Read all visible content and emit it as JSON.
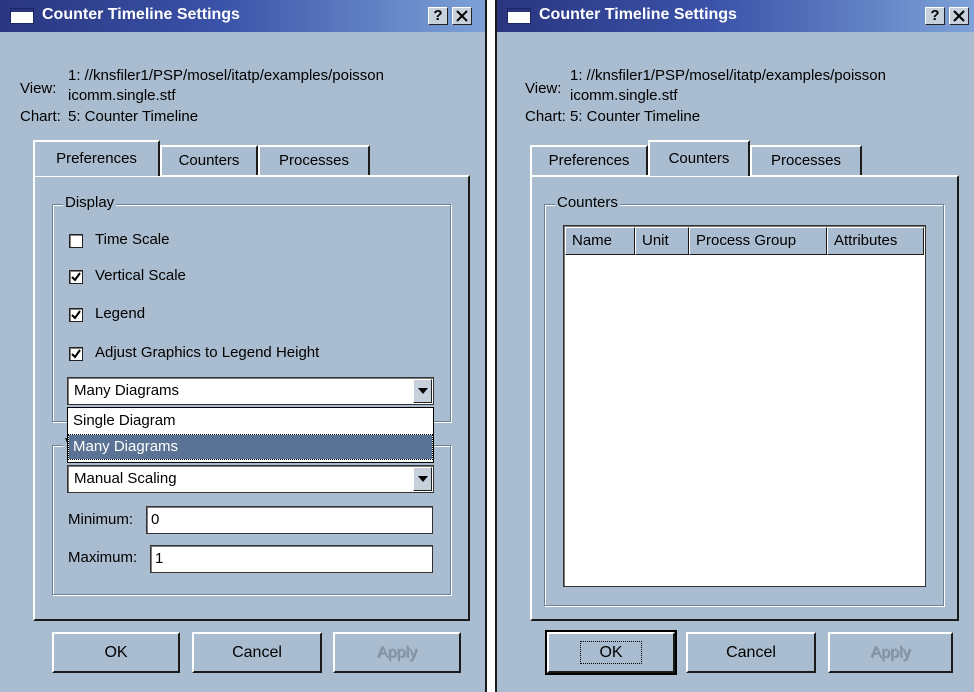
{
  "left_dialog": {
    "title": "Counter Timeline Settings",
    "help_button": "?",
    "close_button": "✕",
    "view_label": "View:",
    "view_value_line1": "1: //knsfiler1/PSP/mosel/itatp/examples/poisson",
    "view_value_line2": "icomm.single.stf",
    "chart_label": "Chart:",
    "chart_value": "5: Counter Timeline",
    "tabs": [
      "Preferences",
      "Counters",
      "Processes"
    ],
    "active_tab": "Preferences",
    "display_group": {
      "label": "Display",
      "checkboxes": [
        {
          "label": "Time Scale",
          "checked": false
        },
        {
          "label": "Vertical Scale",
          "checked": true
        },
        {
          "label": "Legend",
          "checked": true
        },
        {
          "label": "Adjust Graphics to Legend Height",
          "checked": true
        }
      ],
      "diagram_combo_value": "Many Diagrams",
      "diagram_options": [
        "Single Diagram",
        "Many Diagrams"
      ],
      "diagram_selected_option": "Many Diagrams"
    },
    "scaling_group": {
      "label_fragment": "V",
      "scaling_combo_value": "Manual Scaling",
      "minimum_label": "Minimum:",
      "minimum_value": "0",
      "maximum_label": "Maximum:",
      "maximum_value": "1"
    },
    "buttons": {
      "ok": "OK",
      "cancel": "Cancel",
      "apply": "Apply"
    }
  },
  "right_dialog": {
    "title": "Counter Timeline Settings",
    "help_button": "?",
    "close_button": "✕",
    "view_label": "View:",
    "view_value_line1": "1: //knsfiler1/PSP/mosel/itatp/examples/poisson",
    "view_value_line2": "icomm.single.stf",
    "chart_label": "Chart:",
    "chart_value": "5: Counter Timeline",
    "tabs": [
      "Preferences",
      "Counters",
      "Processes"
    ],
    "active_tab": "Counters",
    "counters_group": {
      "label": "Counters",
      "columns": [
        "Name",
        "Unit",
        "Process Group",
        "Attributes"
      ],
      "rows": []
    },
    "buttons": {
      "ok": "OK",
      "cancel": "Cancel",
      "apply": "Apply"
    }
  },
  "colors": {
    "dialog_bg": "#aabccf",
    "titlebar_start": "#2a3680",
    "titlebar_end": "#7ea2d8",
    "selection": "#5a7394"
  }
}
